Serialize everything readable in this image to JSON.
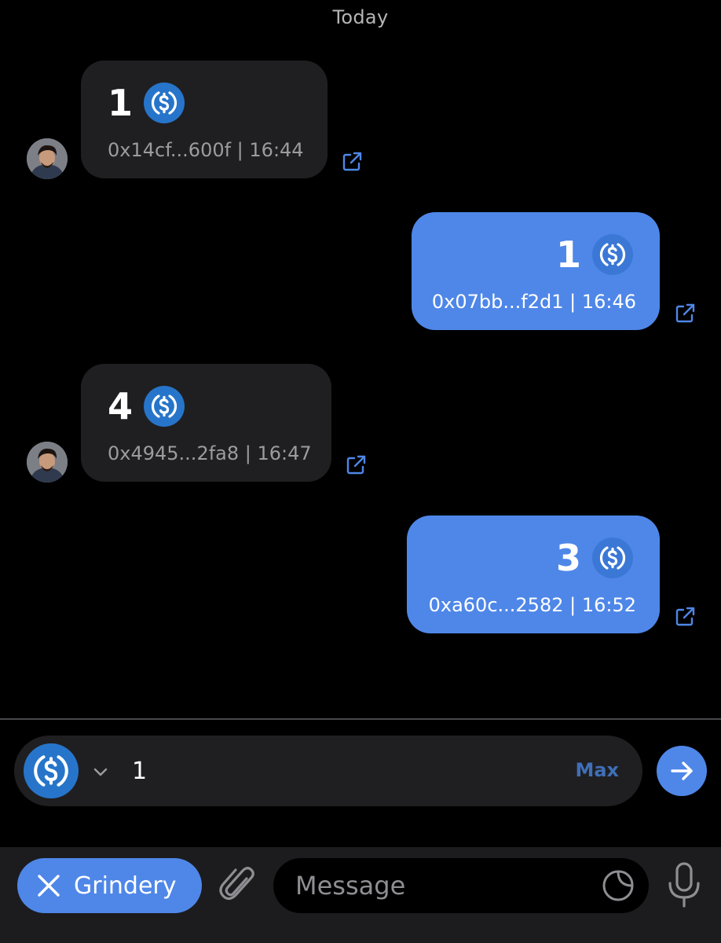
{
  "chat": {
    "date_label": "Today",
    "messages": [
      {
        "direction": "in",
        "amount": "1",
        "token_icon": "usdc-icon",
        "meta": "0x14cf...600f | 16:44"
      },
      {
        "direction": "out",
        "amount": "1",
        "token_icon": "usdc-icon",
        "meta": "0x07bb...f2d1 | 16:46"
      },
      {
        "direction": "in",
        "amount": "4",
        "token_icon": "usdc-icon",
        "meta": "0x4945...2fa8 | 16:47"
      },
      {
        "direction": "out",
        "amount": "3",
        "token_icon": "usdc-icon",
        "meta": "0xa60c...2582 | 16:52"
      }
    ]
  },
  "send_panel": {
    "token_icon": "usdc-icon",
    "amount_value": "1",
    "max_label": "Max",
    "send_icon": "arrow-right-icon"
  },
  "bottom_bar": {
    "bot_button_label": "Grindery",
    "message_placeholder": "Message",
    "attach_icon": "paperclip-icon",
    "sticker_icon": "sticker-icon",
    "mic_icon": "microphone-icon"
  },
  "colors": {
    "accent": "#4f87e8",
    "incoming_bubble": "#1f1f21",
    "usdc": "#2775ca",
    "max_text": "#3f6fb8"
  }
}
